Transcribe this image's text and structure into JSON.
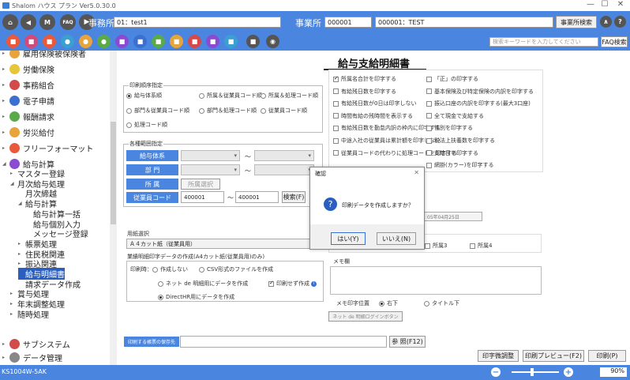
{
  "window": {
    "title": "Shalom ハウス プラン Ver5.0.30.0",
    "min": "—",
    "max": "☐",
    "close": "✕"
  },
  "header": {
    "jigyosho_label": "事務所",
    "jigyosho_value": "01：test1",
    "jigyosho2_label": "事業所",
    "code_value": "000001",
    "name_value": "000001：TEST",
    "search_btn": "事業所検索",
    "faq": "FAQ",
    "home": "home",
    "back": "back",
    "menu": "M",
    "nav_next": "next"
  },
  "toolbar": {
    "search_placeholder": "検索キーワードを入力してください",
    "faq_search": "FAQ検索"
  },
  "sidebar": {
    "items": [
      {
        "label": "雇用保険被保険者",
        "depth": 0,
        "color": "#e8a33b",
        "tri": "▸"
      },
      {
        "label": "労働保険",
        "depth": 0,
        "color": "#e8c63b",
        "tri": "▸"
      },
      {
        "label": "事務組合",
        "depth": 0,
        "color": "#d24a4a",
        "tri": "▸"
      },
      {
        "label": "電子申請",
        "depth": 0,
        "color": "#3b6fd2",
        "tri": "▸"
      },
      {
        "label": "報酬請求",
        "depth": 0,
        "color": "#5aaa4a",
        "tri": "▸"
      },
      {
        "label": "労災給付",
        "depth": 0,
        "color": "#e8a33b",
        "tri": "▸"
      },
      {
        "label": "フリーフォーマット",
        "depth": 0,
        "color": "#e85a3b",
        "tri": "▸"
      },
      {
        "label": "給与計算",
        "depth": 0,
        "color": "#8a4ad2",
        "tri": "◢"
      }
    ],
    "subitems": [
      {
        "label": "マスター登録",
        "indent": 1,
        "tri": "▸"
      },
      {
        "label": "月次給与処理",
        "indent": 1,
        "tri": "◢"
      },
      {
        "label": "月次締越",
        "indent": 2,
        "tri": ""
      },
      {
        "label": "給与計算",
        "indent": 2,
        "tri": "◢"
      },
      {
        "label": "給与計算一括",
        "indent": 3,
        "tri": ""
      },
      {
        "label": "給与個別入力",
        "indent": 3,
        "tri": ""
      },
      {
        "label": "メッセージ登録",
        "indent": 3,
        "tri": ""
      },
      {
        "label": "帳票処理",
        "indent": 2,
        "tri": "▸"
      },
      {
        "label": "住民税関連",
        "indent": 2,
        "tri": "▸"
      },
      {
        "label": "振込関連",
        "indent": 2,
        "tri": "▸"
      },
      {
        "label": "給与明細書",
        "indent": 2,
        "tri": "",
        "selected": true
      },
      {
        "label": "請求データ作成",
        "indent": 2,
        "tri": ""
      },
      {
        "label": "賞与処理",
        "indent": 1,
        "tri": "▸"
      },
      {
        "label": "年末調整処理",
        "indent": 1,
        "tri": "▸"
      },
      {
        "label": "随時処理",
        "indent": 1,
        "tri": "▸"
      }
    ],
    "bottom": [
      {
        "label": "サブシステム",
        "color": "#d24a4a",
        "tri": "▸"
      },
      {
        "label": "データ管理",
        "color": "#888",
        "tri": "▸"
      }
    ]
  },
  "form": {
    "title": "給与支給明細書",
    "order_label": "印刷順序指定",
    "order": [
      "給与体系順",
      "所属＆従業員コード順",
      "所属＆処理コード順",
      "部門＆従業員コード順",
      "部門＆処理コード順",
      "従業員コード順",
      "処理コード順"
    ],
    "range_label": "各種範囲指定",
    "kyuyo_taikei": "給与体系",
    "bumon": "部 門",
    "shozoku": "所 属",
    "shozoku_btn": "所属選択",
    "employee_code": "従業員コード",
    "code_from": "400001",
    "code_to": "400001",
    "tilde": "～",
    "search_f": "検索(F)",
    "paper_label": "用紙選択",
    "paper_value": "Ａ４カット紙（従業員用）",
    "pdf_label": "業績明細印字データの作成(A4カット紙(従業員用)のみ)",
    "print_label": "印刷時：",
    "pdf_opts": [
      "作成しない",
      "CSV形式のファイルを作成",
      "ネット de 明細用にデータを作成",
      "DirectHR用にデータを作成"
    ],
    "no_print": "印刷せず作成",
    "checks": [
      {
        "label": "所属名合計を印字する",
        "on": true
      },
      {
        "label": "「正」の印字する",
        "on": false
      },
      {
        "label": "有給残日数を印字する",
        "on": false
      },
      {
        "label": "基本保険及び特定保険の内訳を印字する",
        "on": false
      },
      {
        "label": "有給残日数が0日は印字しない",
        "on": false
      },
      {
        "label": "振込口座の内訳を印字する(最大3口座)",
        "on": false
      },
      {
        "label": "時間有給の残時間を表示する",
        "on": false
      },
      {
        "label": "全て現金で支給する",
        "on": false
      },
      {
        "label": "有給残日数を勤怠内訳の枠内に印字する",
        "on": false
      },
      {
        "label": "性別を印字する",
        "on": false
      },
      {
        "label": "中途入社の従業員は累計額を印字しない",
        "on": false
      },
      {
        "label": "税法上扶養数を印字する",
        "on": false
      },
      {
        "label": "従業員コードの代わりに処理コードを印字する",
        "on": false
      },
      {
        "label": "支給日を印字する",
        "on": false
      },
      {
        "label": "",
        "on": false
      },
      {
        "label": "網掛(カラー)を印字する",
        "on": false
      }
    ],
    "date_fragment": "05年04月25日",
    "shozoku_checks": [
      "所属3",
      "所属4"
    ],
    "memo_label": "メモ欄",
    "memo_pos_label": "メモ印字位置",
    "memo_pos": [
      "右下",
      "タイトル下"
    ],
    "net_login": "ネット de 明細ログインボタン",
    "save_label": "印刷する帳票の保存先",
    "browse": "参 照(F12)",
    "print_adjust": "印字微調整",
    "preview": "印刷プレビュー(F2)",
    "print": "印刷(P)"
  },
  "dialog": {
    "title": "確認",
    "message": "印刷データを作成しますか？",
    "yes": "はい(Y)",
    "no": "いいえ(N)",
    "close": "✕"
  },
  "status": {
    "code": "KS1004W-5AK",
    "zoom": "90%",
    "minus": "−",
    "plus": "+"
  }
}
